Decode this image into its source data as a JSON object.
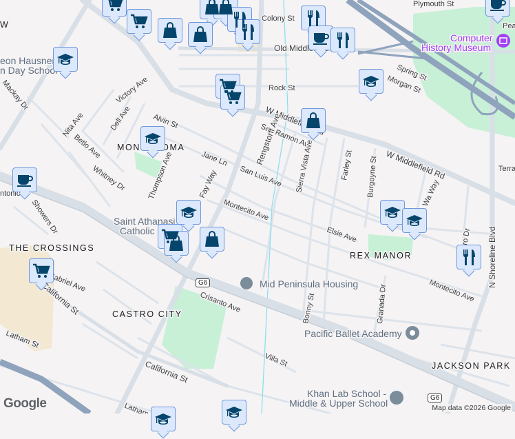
{
  "colors": {
    "marker_bg": "#dce8fb",
    "marker_border": "#6f97dc",
    "icon": "#05456b",
    "park": "#c7f0d6",
    "freeway": "#8fa3bd",
    "road": "#d8dfe6",
    "poi_museum": "#a142f4"
  },
  "streets": {
    "colony": "Colony St",
    "plymouth": "Plymouth St",
    "old_middlefield": "Old Middlefield Wa",
    "spring": "Spring St",
    "morgan": "Morgan St",
    "rock": "Rock St",
    "w_middlefield_1": "W Middlefield Rd",
    "w_middlefield_2": "W Middlefield Rd",
    "san_ramon": "San Ramon Ave",
    "san_luis": "San Luis Ave",
    "sierra_vista": "Sierra Vista Ave",
    "farley": "Farley St",
    "burgoyne": "Burgoyne St",
    "way": "Wa Way",
    "rengstorff": "Rengstorff Ave",
    "victory": "Victory Ave",
    "dell": "Dell Ave",
    "alvin": "Alvin St",
    "nita": "Nita Ave",
    "betlo": "Betlo Ave",
    "mackay": "Mackay Dr",
    "whitney": "Whitney Dr",
    "thompson": "Thompson Ave",
    "jane": "Jane Ln",
    "fay": "Fay Way",
    "montecito_1": "Montecito Ave",
    "montecito_2": "Montecito Ave",
    "elsie": "Elsie Ave",
    "showers": "Showers Dr",
    "gabriel": "Gabriel Ave",
    "california_1": "California St",
    "california_2": "California St",
    "latham_1": "Latham St",
    "latham_2": "Latham St",
    "crisanto": "Crisanto Ave",
    "bonny": "Bonny St",
    "granada": "Granada Dr",
    "villa": "Villa St",
    "shoreline": "N Shoreline Blvd",
    "terra": "Terra",
    "pear": "Pear",
    "antonio": "ntonio",
    "lro": "ro Dr"
  },
  "neighborhoods": {
    "monta_loma": "MONTA LOMA",
    "crossings": "THE CROSSINGS",
    "castro_city": "CASTRO CITY",
    "rex_manor": "REX MANOR",
    "jackson_park": "JACKSON PARK",
    "w": "W"
  },
  "places": {
    "computer_history_1": "Computer",
    "computer_history_2": "History Museum",
    "hausner_1": "eon Hausner",
    "hausner_2": "n Day School",
    "athanasius_1": "Saint Athanasi",
    "athanasius_2": "Catholic",
    "mid_peninsula": "Mid Peninsula Housing",
    "pacific_ballet": "Pacific Ballet Academy",
    "khan_1": "Khan Lab School -",
    "khan_2": "Middle & Upper School"
  },
  "shields": {
    "g6_a": "G6",
    "g6_b": "G6"
  },
  "attribution": "Map data ©2026 Google",
  "logo": "Google",
  "markers": [
    {
      "type": "cart"
    },
    {
      "type": "cart"
    },
    {
      "type": "bag"
    },
    {
      "type": "bag"
    },
    {
      "type": "bag"
    },
    {
      "type": "bag"
    },
    {
      "type": "fork-knife"
    },
    {
      "type": "fork-knife"
    },
    {
      "type": "fork-knife"
    },
    {
      "type": "cup"
    },
    {
      "type": "fork-knife"
    },
    {
      "type": "cup"
    },
    {
      "type": "grad-cap"
    },
    {
      "type": "cart"
    },
    {
      "type": "cart"
    },
    {
      "type": "bag"
    },
    {
      "type": "grad-cap"
    },
    {
      "type": "grad-cap"
    },
    {
      "type": "cup"
    },
    {
      "type": "grad-cap"
    },
    {
      "type": "cart"
    },
    {
      "type": "bag"
    },
    {
      "type": "bag"
    },
    {
      "type": "grad-cap"
    },
    {
      "type": "grad-cap"
    },
    {
      "type": "fork-knife"
    },
    {
      "type": "cart"
    },
    {
      "type": "grad-cap"
    },
    {
      "type": "grad-cap"
    }
  ]
}
